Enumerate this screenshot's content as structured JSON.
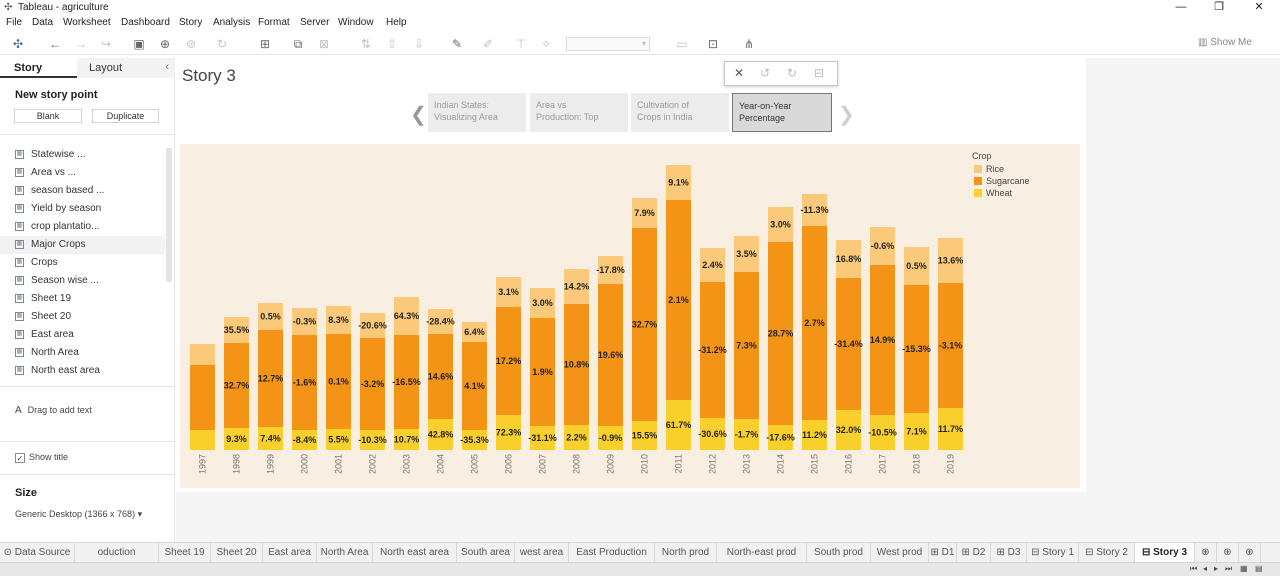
{
  "window": {
    "title": "Tableau - agriculture"
  },
  "menu": [
    "File",
    "Data",
    "Worksheet",
    "Dashboard",
    "Story",
    "Analysis",
    "Format",
    "Server",
    "Window",
    "Help"
  ],
  "toolbar": {
    "show_me": "Show Me"
  },
  "left_panel": {
    "tab_story": "Story",
    "tab_layout": "Layout",
    "new_story_point": "New story point",
    "blank": "Blank",
    "duplicate": "Duplicate",
    "sheets": [
      "Statewise ...",
      "Area vs ...",
      "season based ...",
      "Yield by season",
      "crop plantatio...",
      "Major Crops",
      "Crops",
      "Season wise ...",
      "Sheet 19",
      "Sheet 20",
      "East area",
      "North Area",
      "North east area"
    ],
    "drag_text": "Drag to add text",
    "show_title": "Show title",
    "size_label": "Size",
    "size_value": "Generic Desktop (1366 x 768)"
  },
  "story": {
    "title": "Story 3",
    "points": [
      {
        "line1": "Indian States:",
        "line2": "Visualizing Area"
      },
      {
        "line1": "Area vs",
        "line2": "Production: Top"
      },
      {
        "line1": "Cultivation of",
        "line2": "Crops in India"
      },
      {
        "line1": "Year-on-Year",
        "line2": "Percentage"
      }
    ]
  },
  "colors": {
    "rice": "#fbc97a",
    "sugarcane": "#f39416",
    "wheat": "#f9cf2c",
    "chart_bg": "#f9eee2"
  },
  "chart_data": {
    "type": "bar",
    "stacked": true,
    "legend_title": "Crop",
    "legend_position": "top-right",
    "categories": [
      "1997",
      "1998",
      "1999",
      "2000",
      "2001",
      "2002",
      "2003",
      "2004",
      "2005",
      "2006",
      "2007",
      "2008",
      "2009",
      "2010",
      "2011",
      "2012",
      "2013",
      "2014",
      "2015",
      "2016",
      "2017",
      "2018",
      "2019"
    ],
    "series": [
      {
        "name": "Wheat",
        "color": "#f9cf2c",
        "values": [
          20,
          22,
          23,
          20,
          21,
          20,
          21,
          31,
          20,
          35,
          24,
          25,
          24,
          29,
          50,
          32,
          31,
          25,
          30,
          40,
          35,
          37,
          42
        ],
        "labels": [
          "",
          "9.3%",
          "7.4%",
          "-8.4%",
          "5.5%",
          "-10.3%",
          "10.7%",
          "42.8%",
          "-35.3%",
          "72.3%",
          "-31.1%",
          "2.2%",
          "-0.9%",
          "15.5%",
          "61.7%",
          "-30.6%",
          "-1.7%",
          "-17.6%",
          "11.2%",
          "32.0%",
          "-10.5%",
          "7.1%",
          "11.7%"
        ]
      },
      {
        "name": "Sugarcane",
        "color": "#f39416",
        "values": [
          65,
          85,
          97,
          95,
          95,
          92,
          94,
          85,
          88,
          108,
          108,
          121,
          142,
          193,
          200,
          136,
          147,
          183,
          194,
          132,
          150,
          128,
          125
        ],
        "labels": [
          "",
          "32.7%",
          "12.7%",
          "-1.6%",
          "0.1%",
          "-3.2%",
          "-16.5%",
          "14.6%",
          "4.1%",
          "17.2%",
          "1.9%",
          "10.8%",
          "19.6%",
          "32.7%",
          "2.1%",
          "-31.2%",
          "7.3%",
          "28.7%",
          "2.7%",
          "-31.4%",
          "14.9%",
          "-15.3%",
          "-3.1%"
        ]
      },
      {
        "name": "Rice",
        "color": "#fbc97a",
        "values": [
          21,
          26,
          27,
          27,
          28,
          25,
          38,
          25,
          20,
          30,
          30,
          35,
          28,
          30,
          35,
          34,
          36,
          35,
          32,
          38,
          38,
          38,
          45
        ],
        "labels": [
          "",
          "35.5%",
          "0.5%",
          "-0.3%",
          "8.3%",
          "-20.6%",
          "64.3%",
          "-28.4%",
          "6.4%",
          "3.1%",
          "3.0%",
          "14.2%",
          "-17.8%",
          "7.9%",
          "9.1%",
          "2.4%",
          "3.5%",
          "3.0%",
          "-11.3%",
          "16.8%",
          "-0.6%",
          "0.5%",
          "13.6%"
        ]
      }
    ]
  },
  "bottom_tabs": [
    "Data Source",
    "oduction",
    "Sheet 19",
    "Sheet 20",
    "East area",
    "North Area",
    "North east area",
    "South area",
    "west area",
    "East Production",
    "North prod",
    "North-east prod",
    "South prod",
    "West prod",
    "D1",
    "D2",
    "D3",
    "Story 1",
    "Story 2",
    "Story 3"
  ],
  "active_tab": "Story 3"
}
